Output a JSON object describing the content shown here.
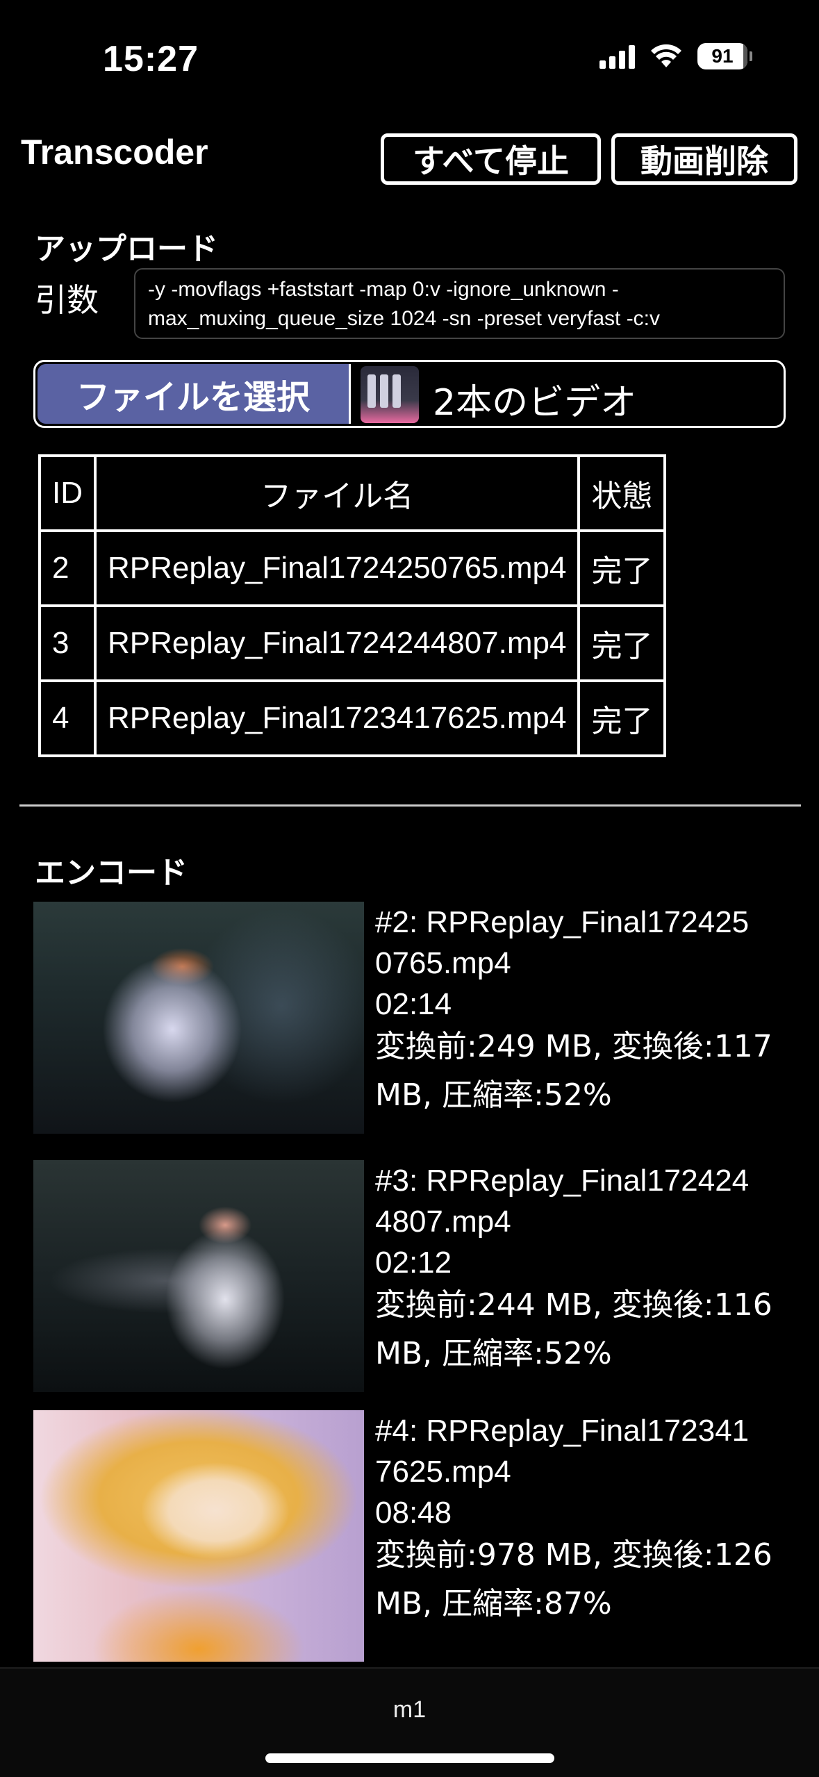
{
  "status_bar": {
    "time": "15:27",
    "battery": "91",
    "battery_level": 0.91
  },
  "header": {
    "title": "Transcoder",
    "stop_all_label": "すべて停止",
    "delete_videos_label": "動画削除"
  },
  "upload": {
    "title": "アップロード",
    "args_label": "引数",
    "args_value": "-y -movflags +faststart -map 0:v -ignore_unknown -max_muxing_queue_size 1024 -sn -preset veryfast -c:v",
    "choose_file_label": "ファイルを選択",
    "selected_files": "2本のビデオ",
    "table": {
      "headers": [
        "ID",
        "ファイル名",
        "状態"
      ],
      "rows": [
        {
          "id": "2",
          "name": "RPReplay_Final1724250765.mp4",
          "status": "完了"
        },
        {
          "id": "3",
          "name": "RPReplay_Final1724244807.mp4",
          "status": "完了"
        },
        {
          "id": "4",
          "name": "RPReplay_Final1723417625.mp4",
          "status": "完了"
        }
      ]
    }
  },
  "encode": {
    "title": "エンコード",
    "items": [
      {
        "name_line1": "#2: RPReplay_Final172425",
        "name_line2": "0765.mp4",
        "duration": "02:14",
        "stats_line1": "変換前:249 MB, 変換後:117",
        "stats_line2": "MB, 圧縮率:52%"
      },
      {
        "name_line1": "#3: RPReplay_Final172424",
        "name_line2": "4807.mp4",
        "duration": "02:12",
        "stats_line1": "変換前:244 MB, 変換後:116",
        "stats_line2": "MB, 圧縮率:52%"
      },
      {
        "name_line1": "#4: RPReplay_Final172341",
        "name_line2": "7625.mp4",
        "duration": "08:48",
        "stats_line1": "変換前:978 MB, 変換後:126",
        "stats_line2": "MB, 圧縮率:87%"
      }
    ]
  },
  "bottom_bar": {
    "url": "m1"
  }
}
